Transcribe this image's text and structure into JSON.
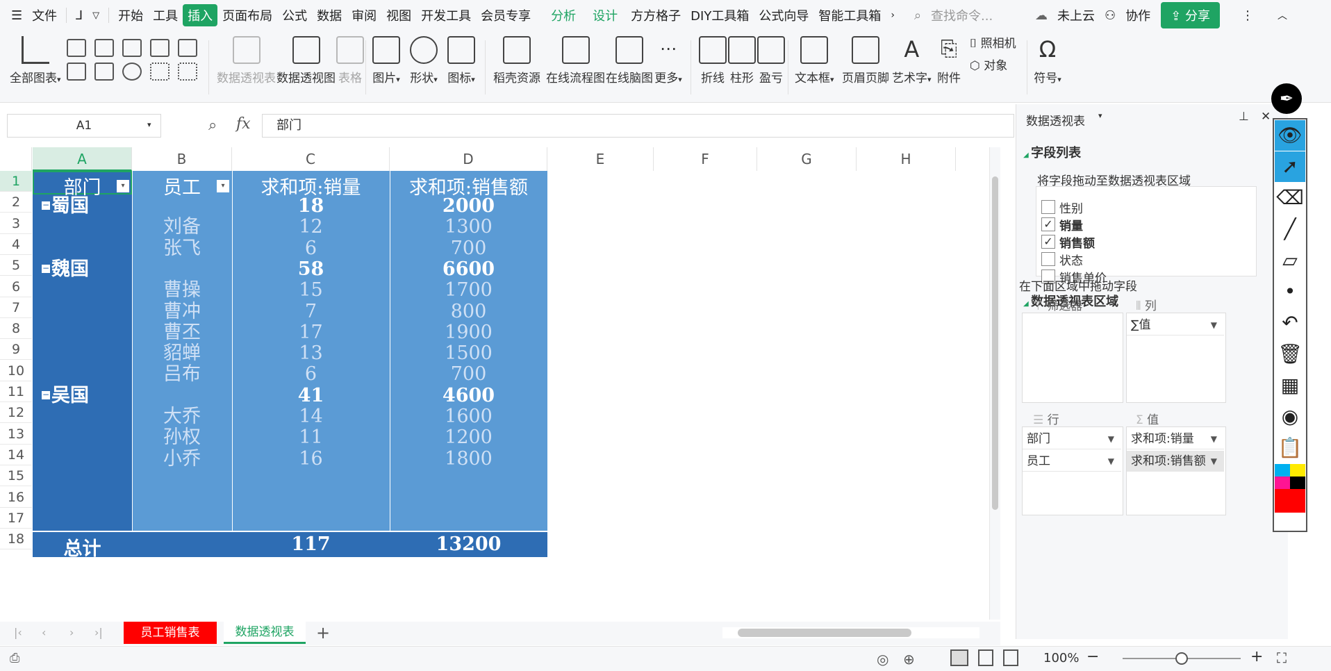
{
  "menu": {
    "file": "文件",
    "tabs": [
      "开始",
      "工具",
      "插入",
      "页面布局",
      "公式",
      "数据",
      "审阅",
      "视图",
      "开发工具",
      "会员专享"
    ],
    "context_tabs": [
      "分析",
      "设计"
    ],
    "extra_tabs": [
      "方方格子",
      "DIY工具箱",
      "公式向导",
      "智能工具箱"
    ],
    "search_placeholder": "查找命令...",
    "cloud": "未上云",
    "collab": "协作",
    "share": "分享"
  },
  "ribbon": {
    "all_charts": "全部图表",
    "pivot_table": "数据透视表",
    "pivot_chart": "数据透视图",
    "table": "表格",
    "picture": "图片",
    "shape": "形状",
    "icon": "图标",
    "docer": "稻壳资源",
    "flowchart": "在线流程图",
    "mindmap": "在线脑图",
    "more": "更多",
    "sparkline_line": "折线",
    "sparkline_column": "柱形",
    "sparkline_winloss": "盈亏",
    "textbox": "文本框",
    "header_footer": "页眉页脚",
    "wordart": "艺术字",
    "attachment": "附件",
    "camera": "照相机",
    "object": "对象",
    "symbol": "符号"
  },
  "formula": {
    "namebox": "A1",
    "fx": "fx",
    "content": "部门"
  },
  "grid": {
    "columns": [
      "A",
      "B",
      "C",
      "D",
      "E",
      "F",
      "G",
      "H"
    ],
    "rows": [
      "1",
      "2",
      "3",
      "4",
      "5",
      "6",
      "7",
      "8",
      "9",
      "10",
      "11",
      "12",
      "13",
      "14",
      "15",
      "16",
      "17",
      "18"
    ],
    "header": [
      "部门",
      "员工",
      "求和项:销量",
      "求和项:销售额"
    ],
    "data": [
      {
        "dept": "蜀国",
        "emp": "",
        "qty": "18",
        "amt": "2000",
        "group": true
      },
      {
        "dept": "",
        "emp": "刘备",
        "qty": "12",
        "amt": "1300",
        "group": false
      },
      {
        "dept": "",
        "emp": "张飞",
        "qty": "6",
        "amt": "700",
        "group": false
      },
      {
        "dept": "魏国",
        "emp": "",
        "qty": "58",
        "amt": "6600",
        "group": true
      },
      {
        "dept": "",
        "emp": "曹操",
        "qty": "15",
        "amt": "1700",
        "group": false
      },
      {
        "dept": "",
        "emp": "曹冲",
        "qty": "7",
        "amt": "800",
        "group": false
      },
      {
        "dept": "",
        "emp": "曹丕",
        "qty": "17",
        "amt": "1900",
        "group": false
      },
      {
        "dept": "",
        "emp": "貂蝉",
        "qty": "13",
        "amt": "1500",
        "group": false
      },
      {
        "dept": "",
        "emp": "吕布",
        "qty": "6",
        "amt": "700",
        "group": false
      },
      {
        "dept": "吴国",
        "emp": "",
        "qty": "41",
        "amt": "4600",
        "group": true
      },
      {
        "dept": "",
        "emp": "大乔",
        "qty": "14",
        "amt": "1600",
        "group": false
      },
      {
        "dept": "",
        "emp": "孙权",
        "qty": "11",
        "amt": "1200",
        "group": false
      },
      {
        "dept": "",
        "emp": "小乔",
        "qty": "16",
        "amt": "1800",
        "group": false
      }
    ],
    "total": {
      "label": "总计",
      "qty": "117",
      "amt": "13200"
    }
  },
  "panel": {
    "title": "数据透视表",
    "field_list": "字段列表",
    "field_hint": "将字段拖动至数据透视表区域",
    "fields": [
      {
        "name": "性别",
        "checked": false
      },
      {
        "name": "销量",
        "checked": true
      },
      {
        "name": "销售额",
        "checked": true
      },
      {
        "name": "状态",
        "checked": false
      },
      {
        "name": "销售单价",
        "checked": false
      }
    ],
    "areas_title": "数据透视表区域",
    "areas_hint": "在下面区域中拖动字段",
    "filter": "筛选器",
    "column": "列",
    "row": "行",
    "values": "值",
    "column_items": [
      "∑值"
    ],
    "row_items": [
      "部门",
      "员工"
    ],
    "value_items": [
      "求和项:销量",
      "求和项:销售额"
    ]
  },
  "sheets": {
    "tabs": [
      "员工销售表",
      "数据透视表"
    ],
    "active": "数据透视表",
    "add": "+"
  },
  "status": {
    "zoom": "100%"
  },
  "colors": {
    "accent": "#1fa463",
    "pivot_dark": "#2e6db4",
    "pivot_light": "#5b9bd5",
    "sheet_tab_red": "#ff0000"
  }
}
